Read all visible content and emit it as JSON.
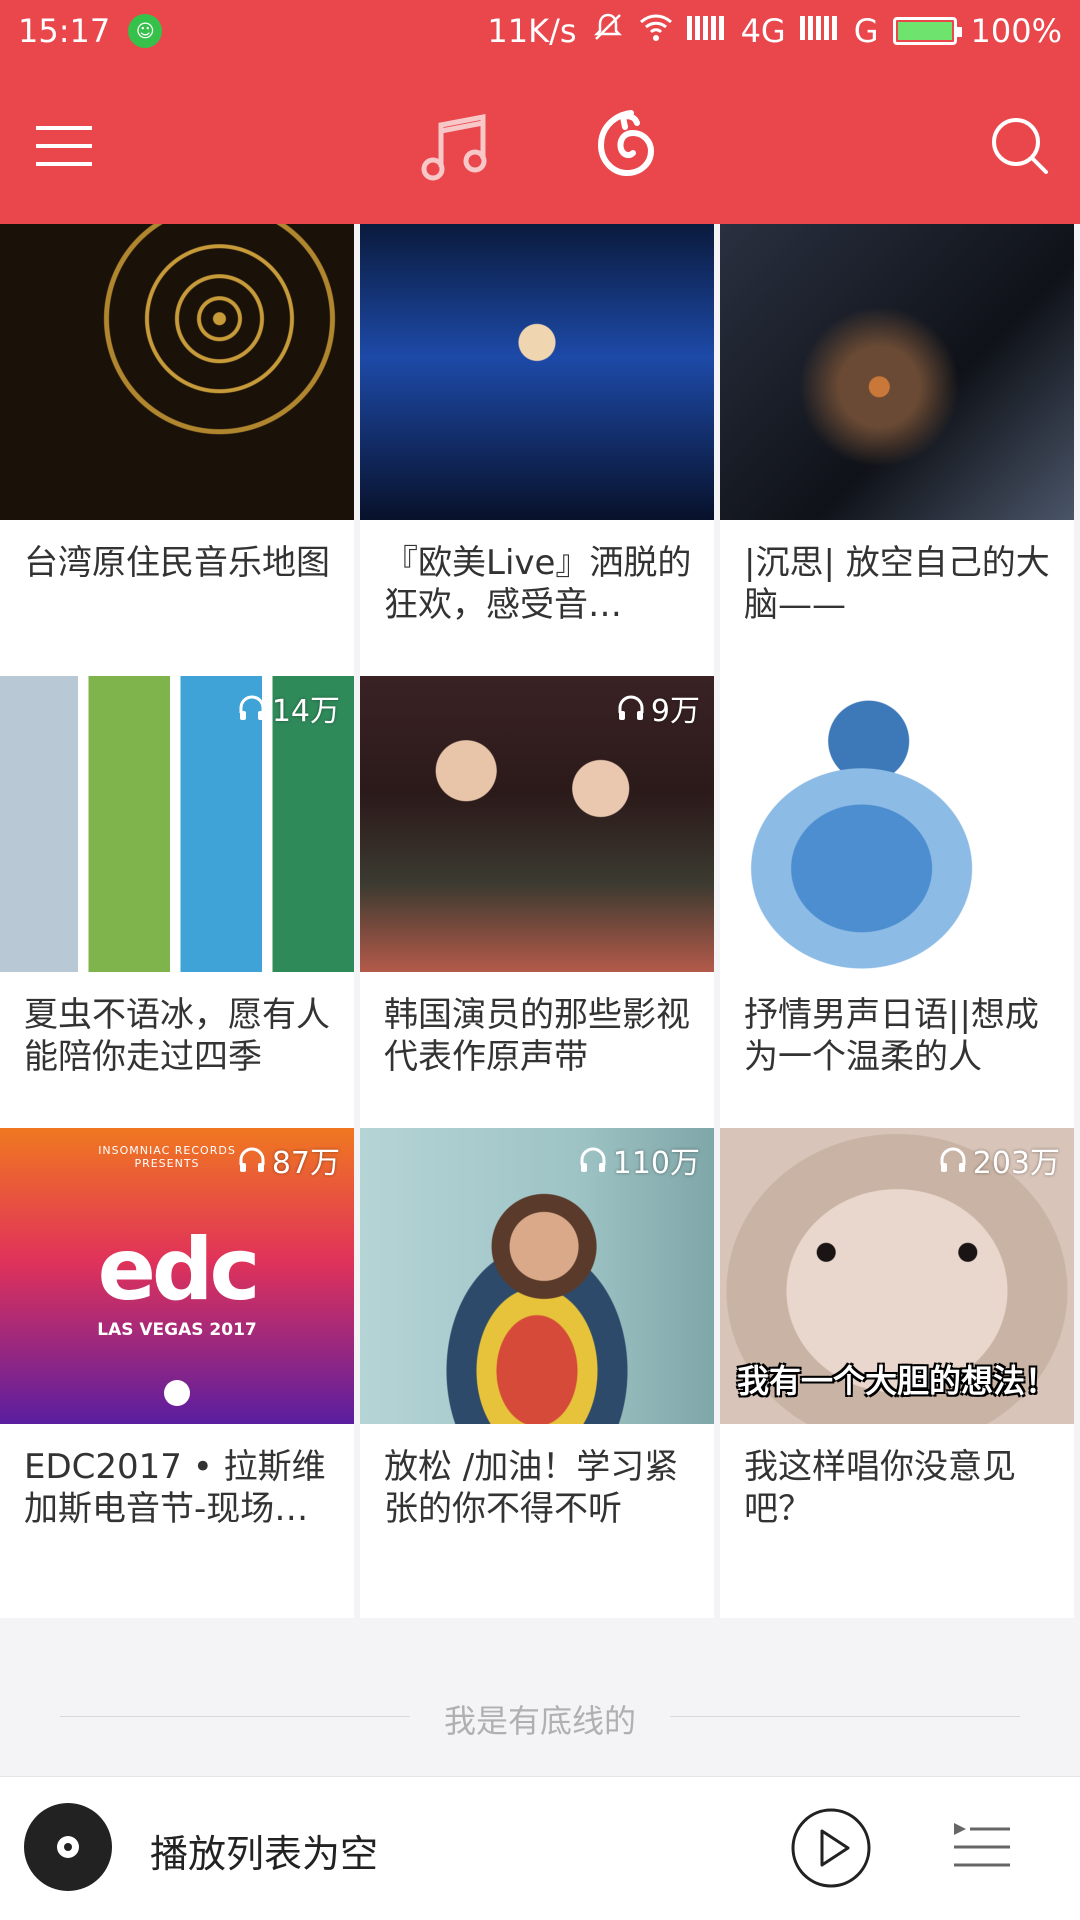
{
  "status_bar": {
    "time": "15:17",
    "app_badge": "☺",
    "net_speed": "11K/s",
    "signal_1": "4G",
    "signal_2": "G",
    "battery": "100%"
  },
  "app_bar": {
    "icons": [
      "menu-icon",
      "music-note-icon",
      "netease-cloud-icon",
      "search-icon"
    ],
    "accent_color": "#e9474c"
  },
  "playlists": [
    {
      "title": "台湾原住民音乐地图",
      "plays": "",
      "cover_colors": [
        "#1a1108",
        "#c79a3a"
      ]
    },
    {
      "title": "『欧美Live』洒脱的狂欢，感受音…",
      "plays": "",
      "cover_colors": [
        "#0a1a3c",
        "#2f6bd6"
      ]
    },
    {
      "title": "|沉思| 放空自己的大脑——",
      "plays": "",
      "cover_colors": [
        "#0f1218",
        "#6a4a34"
      ]
    },
    {
      "title": "夏虫不语冰，愿有人能陪你走过四季",
      "plays": "14万",
      "cover_colors": [
        "#dfe6ea",
        "#7fb34b"
      ]
    },
    {
      "title": "韩国演员的那些影视代表作原声带",
      "plays": "9万",
      "cover_colors": [
        "#2b1a1a",
        "#b45a4a"
      ]
    },
    {
      "title": "抒情男声日语||想成为一个温柔的人",
      "plays": "",
      "cover_colors": [
        "#ffffff",
        "#4d8ed0"
      ]
    },
    {
      "title": "EDC2017 • 拉斯维加斯电音节-现场…",
      "plays": "87万",
      "cover_colors": [
        "#f07820",
        "#5a1ea0"
      ],
      "cover_text_main": "edc",
      "cover_text_sub": "LAS VEGAS 2017",
      "cover_text_top": "INSOMNIAC RECORDS PRESENTS"
    },
    {
      "title": "放松 /加油！学习紧张的你不得不听",
      "plays": "110万",
      "cover_colors": [
        "#9fc4c6",
        "#d64a3a"
      ]
    },
    {
      "title": "我这样唱你没意见吧？",
      "plays": "203万",
      "cover_colors": [
        "#c9b3a4",
        "#e9d7cd"
      ],
      "cover_caption": "我有一个大胆的想法！"
    }
  ],
  "footer": {
    "bottom_line": "我是有底线的"
  },
  "player": {
    "status": "播放列表为空"
  }
}
